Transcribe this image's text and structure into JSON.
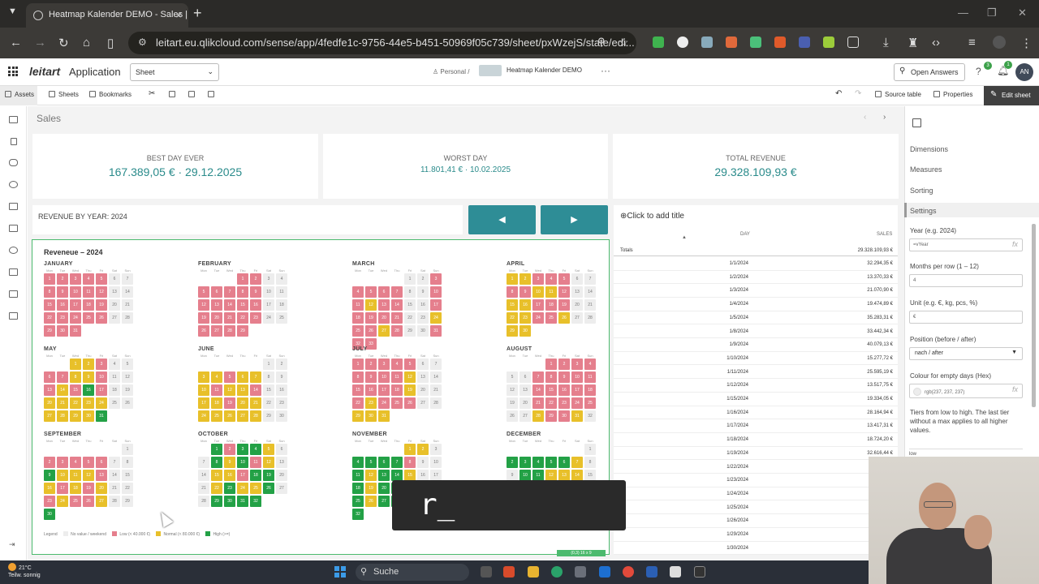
{
  "browser": {
    "tab_title": "Heatmap Kalender DEMO - Sales | Sh",
    "close": "×",
    "new_tab": "+",
    "url": "leitart.eu.qlikcloud.com/sense/app/4fedfe1c-9756-44e5-b451-50969f05c739/sheet/pxWzejS/state/edi..."
  },
  "qlik": {
    "logo": "leitart",
    "app_label": "Application",
    "sheet_dropdown": "Sheet",
    "crumb_personal": "Personal",
    "crumb_sep": "/",
    "app_title": "Heatmap Kalender DEMO",
    "open_answers": "Open Answers",
    "avatar": "AN",
    "help_badge": "3",
    "bell_badge": "1"
  },
  "toolbar": {
    "assets": "Assets",
    "sheets": "Sheets",
    "bookmarks": "Bookmarks",
    "source_table": "Source table",
    "properties": "Properties",
    "edit_sheet": "Edit sheet"
  },
  "sheet": {
    "title": "Sales",
    "kpis": [
      {
        "label": "BEST DAY EVER",
        "value": "167.389,05 € · 29.12.2025"
      },
      {
        "label": "WORST DAY",
        "value": "11.801,41 € · 10.02.2025"
      },
      {
        "label": "TOTAL REVENUE",
        "value": "29.328.109,93 €"
      }
    ],
    "revenue_by_year": "REVENUE BY YEAR: 2024",
    "prev": "◀",
    "next": "▶"
  },
  "calendar": {
    "title": "Reveneue – 2024",
    "dow": [
      "Mon",
      "Tue",
      "Wed",
      "Thu",
      "Fri",
      "Sat",
      "Sun"
    ],
    "months": [
      {
        "name": "JANUARY",
        "offset": 0,
        "days": "lllllnnlllllnnlllllnnlllllnnlll"
      },
      {
        "name": "FEBRUARY",
        "offset": 3,
        "days": "llnnlllllnnlllllnnlllllnnllll"
      },
      {
        "name": "MARCH",
        "offset": 4,
        "days": "nnlllllnnllmllnnlllllnnmllmlnnlll"
      },
      {
        "name": "APRIL",
        "offset": 0,
        "days": "mmlllnnllmmlnnmmlllnnmmllmnnmm"
      },
      {
        "name": "MAY",
        "offset": 2,
        "days": "mmlnnllmmlnnlmlhlnnmmmmmnnmmmmh"
      },
      {
        "name": "JUNE",
        "offset": 5,
        "days": "nnmmlmmnnmlmmlnnmmlmmnnmmmmmnn"
      },
      {
        "name": "JULY",
        "offset": 0,
        "days": "lllllnnllllmnnllllmnnlmlllnnmmm"
      },
      {
        "name": "AUGUST",
        "offset": 3,
        "days": "llllnnlllllnnlllllnnlllllnnmllmn"
      },
      {
        "name": "SEPTEMBER",
        "offset": 6,
        "days": "nlllllnnhmmmlnnmlmlmnnlmllmnnh"
      },
      {
        "name": "OCTOBER",
        "offset": 1,
        "days": "hlhhmnnhmhlmnnmmlhhnnmhmmhnnhhhh"
      },
      {
        "name": "NOVEMBER",
        "offset": 4,
        "days": "mmnhhhhlnnhmhhmnnhmhhmnnhmhhmnnh"
      },
      {
        "name": "DECEMBER",
        "offset": 6,
        "days": "nhhhhhmnnhhmmmnnmhmmmnnhhhhhnnhh"
      }
    ],
    "legend": {
      "title": "Legend",
      "empty": "No value / weekend",
      "low": "Low (< 40.000 €)",
      "normal": "Normal (< 80.000 €)",
      "high": "High (>=)"
    },
    "size_chip": "(0,3) 16 x 9"
  },
  "table": {
    "add_title": "Click to add title",
    "col_day": "DAY",
    "col_sales": "SALES",
    "totals_label": "Totals",
    "totals_value": "29.328.109,93 €",
    "rows": [
      {
        "day": "1/1/2024",
        "sales": "32.294,35 €"
      },
      {
        "day": "1/2/2024",
        "sales": "13.370,33 €"
      },
      {
        "day": "1/3/2024",
        "sales": "21.070,90 €"
      },
      {
        "day": "1/4/2024",
        "sales": "19.474,89 €"
      },
      {
        "day": "1/5/2024",
        "sales": "35.283,31 €"
      },
      {
        "day": "1/8/2024",
        "sales": "33.442,34 €"
      },
      {
        "day": "1/9/2024",
        "sales": "40.079,13 €"
      },
      {
        "day": "1/10/2024",
        "sales": "15.277,72 €"
      },
      {
        "day": "1/11/2024",
        "sales": "25.595,19 €"
      },
      {
        "day": "1/12/2024",
        "sales": "13.517,75 €"
      },
      {
        "day": "1/15/2024",
        "sales": "19.334,05 €"
      },
      {
        "day": "1/16/2024",
        "sales": "28.164,94 €"
      },
      {
        "day": "1/17/2024",
        "sales": "13.417,31 €"
      },
      {
        "day": "1/18/2024",
        "sales": "18.724,20 €"
      },
      {
        "day": "1/19/2024",
        "sales": "32.616,44 €"
      },
      {
        "day": "1/22/2024",
        "sales": "29"
      },
      {
        "day": "1/23/2024",
        "sales": "19"
      },
      {
        "day": "1/24/2024",
        "sales": "30"
      },
      {
        "day": "1/25/2024",
        "sales": "37"
      },
      {
        "day": "1/26/2024",
        "sales": "12"
      },
      {
        "day": "1/29/2024",
        "sales": "30"
      },
      {
        "day": "1/30/2024",
        "sales": "33"
      }
    ]
  },
  "properties": {
    "dimensions": "Dimensions",
    "measures": "Measures",
    "sorting": "Sorting",
    "settings": "Settings",
    "year_label": "Year (e.g. 2024)",
    "year_value": "=vYear",
    "months_label": "Months per row (1 – 12)",
    "months_value": "4",
    "unit_label": "Unit (e.g. €, kg, pcs, %)",
    "unit_value": "€",
    "position_label": "Position (before / after)",
    "position_value": "nach / after",
    "empty_colour_label": "Colour for empty days (Hex)",
    "empty_colour_value": "rgb(237, 237, 237)",
    "tiers_note": "Tiers from low to high. The last tier without a max applies to all higher values.",
    "low_label": "low",
    "fx": "fx"
  },
  "overlay_text": "r_",
  "taskbar": {
    "temp": "21°C",
    "weather": "Teilw. sonnig",
    "search": "Suche"
  },
  "colors": {
    "teal": "#2e8d96",
    "low": "#e57f8d",
    "normal": "#e8c02a",
    "high": "#23a146",
    "empty": "#ededed",
    "selection": "#4cba6e"
  }
}
